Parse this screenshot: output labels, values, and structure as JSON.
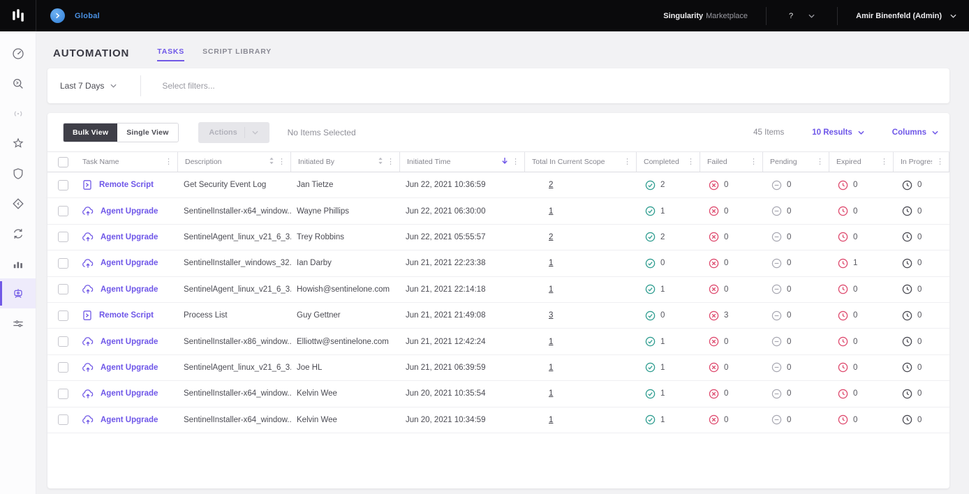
{
  "topbar": {
    "scope_label": "Global",
    "brand": "Singularity",
    "brand_suffix": "Marketplace",
    "help_label": "?",
    "user_label": "Amir Binenfeld (Admin)"
  },
  "page": {
    "title": "AUTOMATION",
    "tabs": [
      {
        "label": "TASKS",
        "active": true
      },
      {
        "label": "SCRIPT LIBRARY",
        "active": false
      }
    ]
  },
  "filters": {
    "time_range": "Last 7 Days",
    "filter_placeholder": "Select filters..."
  },
  "toolbar": {
    "bulk_view": "Bulk View",
    "single_view": "Single View",
    "actions": "Actions",
    "selection_status": "No Items Selected",
    "items_count": "45 Items",
    "results": "10 Results",
    "columns": "Columns"
  },
  "sidebar": {
    "active_item": "automation",
    "items": [
      "dashboard",
      "deep-visibility",
      "network",
      "sentinels",
      "protection",
      "rogues",
      "updates",
      "reports",
      "automation",
      "settings"
    ]
  },
  "table": {
    "columns": [
      {
        "label": "Task Name",
        "sort": "kebab"
      },
      {
        "label": "Description",
        "sort": "both"
      },
      {
        "label": "Initiated By",
        "sort": "both"
      },
      {
        "label": "Initiated Time",
        "sort": "desc"
      },
      {
        "label": "Total In Current Scope",
        "sort": "kebab"
      },
      {
        "label": "Completed",
        "sort": "kebab"
      },
      {
        "label": "Failed",
        "sort": "kebab"
      },
      {
        "label": "Pending",
        "sort": "kebab"
      },
      {
        "label": "Expired",
        "sort": "kebab"
      },
      {
        "label": "In Progress",
        "sort": "kebab"
      }
    ],
    "rows": [
      {
        "type": "Remote Script",
        "icon": "script",
        "description": "Get Security Event Log",
        "initiated_by": "Jan Tietze",
        "initiated_time": "Jun 22, 2021 10:36:59",
        "total": "2",
        "completed": "2",
        "failed": "0",
        "pending": "0",
        "expired": "0",
        "in_progress": "0"
      },
      {
        "type": "Agent Upgrade",
        "icon": "cloud",
        "description": "SentinelInstaller-x64_window...",
        "initiated_by": "Wayne Phillips",
        "initiated_time": "Jun 22, 2021 06:30:00",
        "total": "1",
        "completed": "1",
        "failed": "0",
        "pending": "0",
        "expired": "0",
        "in_progress": "0"
      },
      {
        "type": "Agent Upgrade",
        "icon": "cloud",
        "description": "SentinelAgent_linux_v21_6_3...",
        "initiated_by": "Trey Robbins",
        "initiated_time": "Jun 22, 2021 05:55:57",
        "total": "2",
        "completed": "2",
        "failed": "0",
        "pending": "0",
        "expired": "0",
        "in_progress": "0"
      },
      {
        "type": "Agent Upgrade",
        "icon": "cloud",
        "description": "SentinelInstaller_windows_32...",
        "initiated_by": "Ian Darby",
        "initiated_time": "Jun 21, 2021 22:23:38",
        "total": "1",
        "completed": "0",
        "failed": "0",
        "pending": "0",
        "expired": "1",
        "in_progress": "0"
      },
      {
        "type": "Agent Upgrade",
        "icon": "cloud",
        "description": "SentinelAgent_linux_v21_6_3...",
        "initiated_by": "Howish@sentinelone.com",
        "initiated_time": "Jun 21, 2021 22:14:18",
        "total": "1",
        "completed": "1",
        "failed": "0",
        "pending": "0",
        "expired": "0",
        "in_progress": "0"
      },
      {
        "type": "Remote Script",
        "icon": "script",
        "description": "Process List",
        "initiated_by": "Guy Gettner",
        "initiated_time": "Jun 21, 2021 21:49:08",
        "total": "3",
        "completed": "0",
        "failed": "3",
        "pending": "0",
        "expired": "0",
        "in_progress": "0"
      },
      {
        "type": "Agent Upgrade",
        "icon": "cloud",
        "description": "SentinelInstaller-x86_window...",
        "initiated_by": "Elliottw@sentinelone.com",
        "initiated_time": "Jun 21, 2021 12:42:24",
        "total": "1",
        "completed": "1",
        "failed": "0",
        "pending": "0",
        "expired": "0",
        "in_progress": "0"
      },
      {
        "type": "Agent Upgrade",
        "icon": "cloud",
        "description": "SentinelAgent_linux_v21_6_3...",
        "initiated_by": "Joe HL",
        "initiated_time": "Jun 21, 2021 06:39:59",
        "total": "1",
        "completed": "1",
        "failed": "0",
        "pending": "0",
        "expired": "0",
        "in_progress": "0"
      },
      {
        "type": "Agent Upgrade",
        "icon": "cloud",
        "description": "SentinelInstaller-x64_window...",
        "initiated_by": "Kelvin Wee",
        "initiated_time": "Jun 20, 2021 10:35:54",
        "total": "1",
        "completed": "1",
        "failed": "0",
        "pending": "0",
        "expired": "0",
        "in_progress": "0"
      },
      {
        "type": "Agent Upgrade",
        "icon": "cloud",
        "description": "SentinelInstaller-x64_window...",
        "initiated_by": "Kelvin Wee",
        "initiated_time": "Jun 20, 2021 10:34:59",
        "total": "1",
        "completed": "1",
        "failed": "0",
        "pending": "0",
        "expired": "0",
        "in_progress": "0"
      }
    ]
  },
  "colors": {
    "accent_purple": "#6e56e8",
    "completed_teal": "#2f9d90",
    "failed_red": "#de4a6e",
    "pending_gray": "#a8a8b2",
    "expired_red": "#de4a6e",
    "in_progress_dark": "#4c4c54",
    "topbar_bg": "#0a0a0c",
    "scope_blue": "#4a90e2"
  }
}
